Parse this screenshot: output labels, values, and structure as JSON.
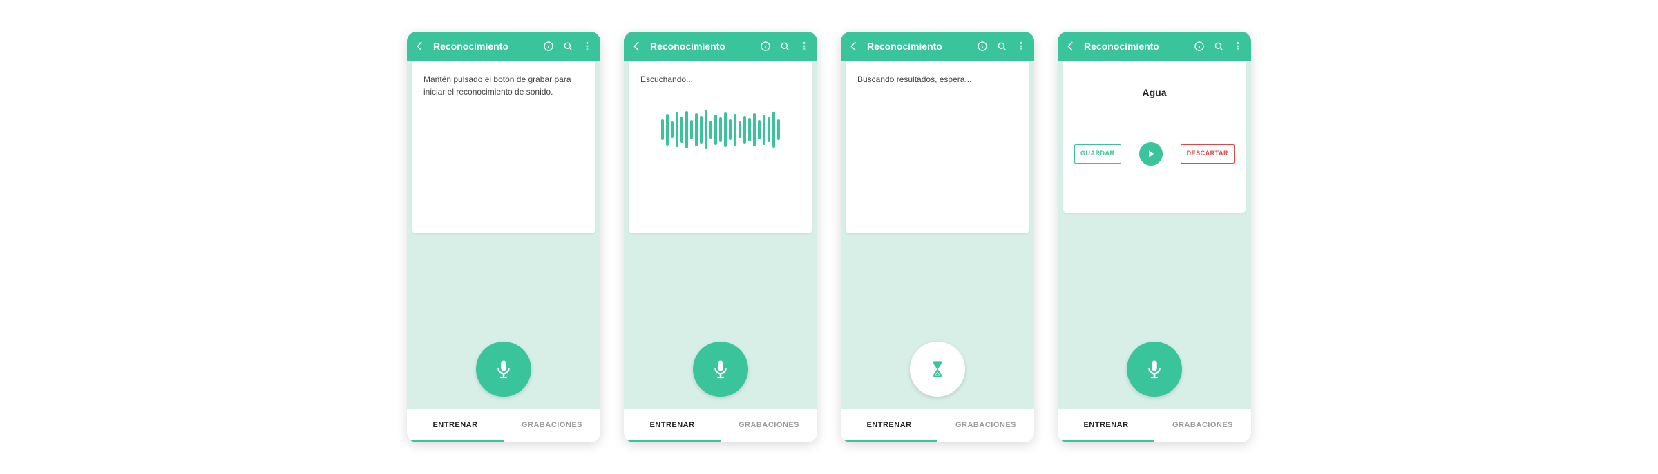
{
  "header": {
    "title": "Reconocimiento"
  },
  "tabs": {
    "train": "ENTRENAR",
    "recordings": "GRABACIONES"
  },
  "screen1": {
    "message": "Mantén pulsado el botón de grabar para iniciar el reconocimiento de sonido."
  },
  "screen2": {
    "message": "Escuchando..."
  },
  "screen3": {
    "message": "Buscando resultados, espera..."
  },
  "screen4": {
    "result_label": "Agua",
    "save": "GUARDAR",
    "discard": "DESCARTAR"
  },
  "wave_heights": [
    30,
    46,
    24,
    50,
    38,
    54,
    28,
    48,
    40,
    56,
    26,
    44,
    36,
    50,
    30,
    46,
    24,
    40,
    34,
    48,
    28,
    44,
    36,
    52,
    30
  ]
}
